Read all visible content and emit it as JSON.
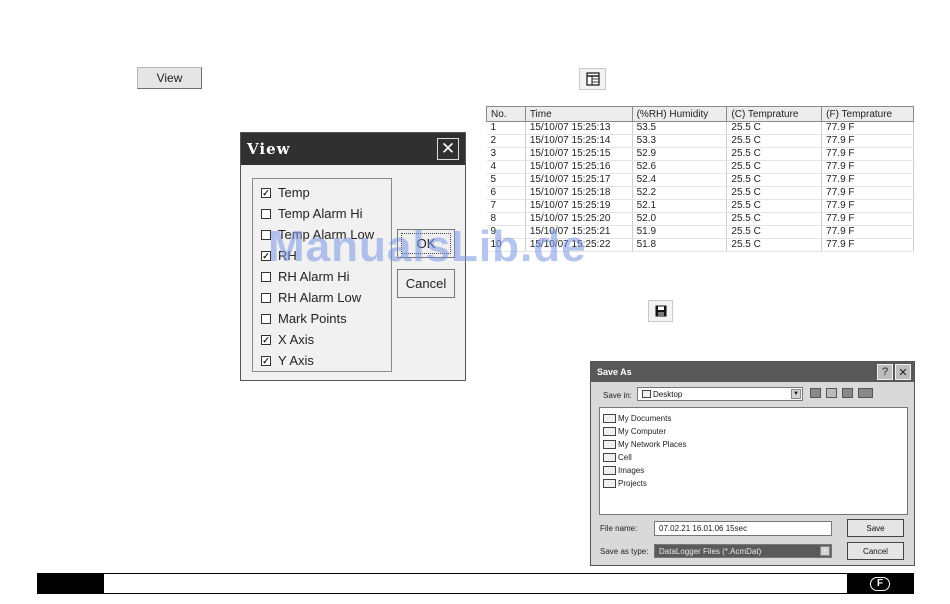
{
  "view_button": {
    "label": "View"
  },
  "view_dialog": {
    "title": "View",
    "close_glyph": "✕",
    "options": [
      {
        "label": "Temp",
        "checked": true
      },
      {
        "label": "Temp Alarm Hi",
        "checked": false
      },
      {
        "label": "Temp Alarm Low",
        "checked": false
      },
      {
        "label": "RH",
        "checked": true
      },
      {
        "label": "RH Alarm Hi",
        "checked": false
      },
      {
        "label": "RH Alarm Low",
        "checked": false
      },
      {
        "label": "Mark Points",
        "checked": false
      },
      {
        "label": "X Axis",
        "checked": true
      },
      {
        "label": "Y Axis",
        "checked": true
      }
    ],
    "ok_label": "OK",
    "cancel_label": "Cancel"
  },
  "data_table": {
    "headers": [
      "No.",
      "Time",
      "(%RH) Humidity",
      "(C) Temprature",
      "(F) Temprature"
    ],
    "rows": [
      [
        "1",
        "15/10/07 15:25:13",
        "53.5",
        "25.5 C",
        "77.9 F"
      ],
      [
        "2",
        "15/10/07 15:25:14",
        "53.3",
        "25.5 C",
        "77.9 F"
      ],
      [
        "3",
        "15/10/07 15:25:15",
        "52.9",
        "25.5 C",
        "77.9 F"
      ],
      [
        "4",
        "15/10/07 15:25:16",
        "52.6",
        "25.5 C",
        "77.9 F"
      ],
      [
        "5",
        "15/10/07 15:25:17",
        "52.4",
        "25.5 C",
        "77.9 F"
      ],
      [
        "6",
        "15/10/07 15:25:18",
        "52.2",
        "25.5 C",
        "77.9 F"
      ],
      [
        "7",
        "15/10/07 15:25:19",
        "52.1",
        "25.5 C",
        "77.9 F"
      ],
      [
        "8",
        "15/10/07 15:25:20",
        "52.0",
        "25.5 C",
        "77.9 F"
      ],
      [
        "9",
        "15/10/07 15:25:21",
        "51.9",
        "25.5 C",
        "77.9 F"
      ],
      [
        "10",
        "15/10/07 15:25:22",
        "51.8",
        "25.5 C",
        "77.9 F"
      ]
    ]
  },
  "watermark": "ManualsLib.de",
  "save_as": {
    "title": "Save As",
    "help_glyph": "?",
    "close_glyph": "✕",
    "save_in_label": "Save in:",
    "save_in_value": "Desktop",
    "items": [
      "My Documents",
      "My Computer",
      "My Network Places",
      "Cell",
      "Images",
      "Projects"
    ],
    "file_name_label": "File name:",
    "file_name_value": "07.02.21 16.01.06 15sec",
    "save_type_label": "Save as type:",
    "save_type_value": "DataLogger Files (*.AcmDat)",
    "save_label": "Save",
    "cancel_label": "Cancel"
  },
  "footer": {
    "language_badge": "F"
  }
}
